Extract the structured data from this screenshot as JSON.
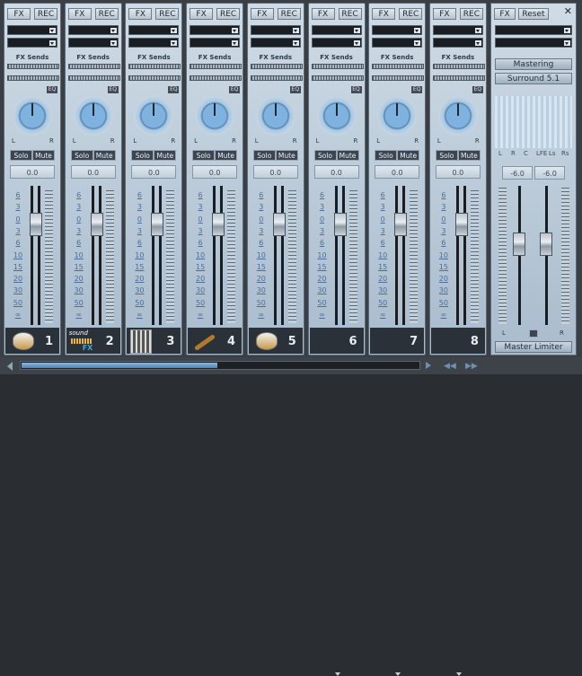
{
  "strip_labels": {
    "fx": "FX",
    "rec": "REC",
    "fx_sends": "FX Sends",
    "eq": "EQ",
    "l": "L",
    "r": "R",
    "solo": "Solo",
    "mute": "Mute",
    "volume": "0.0"
  },
  "scale": [
    "6",
    "3",
    "0",
    "3",
    "6",
    "10",
    "15",
    "20",
    "30",
    "50",
    "∞"
  ],
  "channels": [
    {
      "number": "1",
      "icon": "drum-icon"
    },
    {
      "number": "2",
      "icon": "sound-fx-logo",
      "logo_text": "sound",
      "logo_sub": "FX"
    },
    {
      "number": "3",
      "icon": "fader-icon"
    },
    {
      "number": "4",
      "icon": "guitar-icon"
    },
    {
      "number": "5",
      "icon": "drum-icon"
    },
    {
      "number": "6",
      "icon": "none"
    },
    {
      "number": "7",
      "icon": "none"
    },
    {
      "number": "8",
      "icon": "none"
    }
  ],
  "master": {
    "fx": "FX",
    "reset": "Reset",
    "close": "✕",
    "mastering": "Mastering",
    "surround": "Surround 5.1",
    "channels": [
      "L",
      "R",
      "C",
      "LFE",
      "Ls",
      "Rs"
    ],
    "volume_left": "-6.0",
    "volume_right": "-6.0",
    "l": "L",
    "r": "R",
    "limiter": "Master Limiter"
  },
  "scroll": {
    "position": 0.49
  }
}
